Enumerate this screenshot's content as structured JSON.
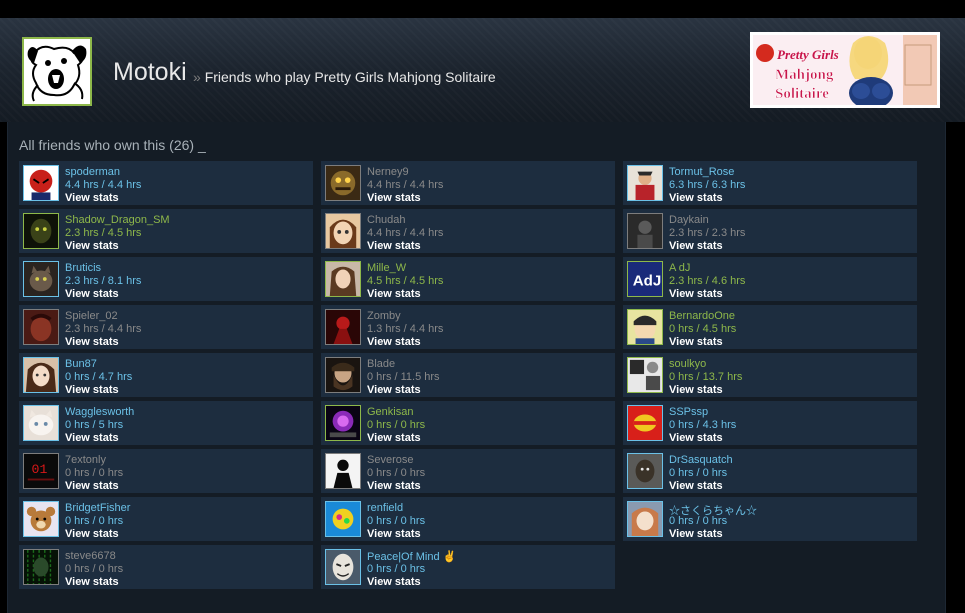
{
  "header": {
    "user_name": "Motoki",
    "separator": "»",
    "subtitle": "Friends who play Pretty Girls Mahjong Solitaire",
    "game_logo_text_1": "Pretty Girls",
    "game_logo_text_2": "Mahjong",
    "game_logo_text_3": "Solitaire"
  },
  "section": {
    "title": "All friends who own this (26) _"
  },
  "colors": {
    "online": "#6bc1e7",
    "in_game": "#8eb84a",
    "offline": "#8a8a8a",
    "card_bg": "#1d2d3f"
  },
  "view_stats_label": "View stats",
  "friends": [
    {
      "name": "spoderman",
      "hours": "4.4 hrs / 4.4 hrs",
      "status": "online",
      "avatar": "red-mask-avatar"
    },
    {
      "name": "Nerney9",
      "hours": "4.4 hrs / 4.4 hrs",
      "status": "offline",
      "avatar": "creature-avatar"
    },
    {
      "name": "Tormut_Rose",
      "hours": "6.3 hrs / 6.3 hrs",
      "status": "online",
      "avatar": "fighter-avatar"
    },
    {
      "name": "Shadow_Dragon_SM",
      "hours": "2.3 hrs / 4.5 hrs",
      "status": "in-game",
      "avatar": "dark-dragon-avatar"
    },
    {
      "name": "Chudah",
      "hours": "4.4 hrs / 4.4 hrs",
      "status": "offline",
      "avatar": "anime-face-avatar"
    },
    {
      "name": "Daykain",
      "hours": "2.3 hrs / 2.3 hrs",
      "status": "offline",
      "avatar": "dark-figure-avatar"
    },
    {
      "name": "Bruticis",
      "hours": "2.3 hrs / 8.1 hrs",
      "status": "online",
      "avatar": "cat-avatar"
    },
    {
      "name": "Mille_W",
      "hours": "4.5 hrs / 4.5 hrs",
      "status": "in-game",
      "avatar": "girl-avatar"
    },
    {
      "name": "A dJ",
      "hours": "2.3 hrs / 4.6 hrs",
      "status": "in-game",
      "avatar": "adj-logo-avatar"
    },
    {
      "name": "Spieler_02",
      "hours": "2.3 hrs / 4.4 hrs",
      "status": "offline",
      "avatar": "red-face-avatar"
    },
    {
      "name": "Zomby",
      "hours": "1.3 hrs / 4.4 hrs",
      "status": "offline",
      "avatar": "red-figure-avatar"
    },
    {
      "name": "BernardoOne",
      "hours": "0 hrs / 4.5 hrs",
      "status": "in-game",
      "avatar": "cartoon-avatar"
    },
    {
      "name": "Bun87",
      "hours": "0 hrs / 4.7 hrs",
      "status": "online",
      "avatar": "girl-face-avatar"
    },
    {
      "name": "Blade",
      "hours": "0 hrs / 11.5 hrs",
      "status": "offline",
      "avatar": "bearded-man-avatar"
    },
    {
      "name": "soulkyo",
      "hours": "0 hrs / 13.7 hrs",
      "status": "in-game",
      "avatar": "manga-avatar"
    },
    {
      "name": "Wagglesworth",
      "hours": "0 hrs / 5 hrs",
      "status": "online",
      "avatar": "kitten-avatar"
    },
    {
      "name": "Genkisan",
      "hours": "0 hrs / 0 hrs",
      "status": "in-game",
      "avatar": "purple-orb-avatar"
    },
    {
      "name": "SSPssp",
      "hours": "0 hrs / 4.3 hrs",
      "status": "online",
      "avatar": "red-yellow-avatar"
    },
    {
      "name": "7extonly",
      "hours": "0 hrs / 0 hrs",
      "status": "offline",
      "avatar": "text-01-avatar"
    },
    {
      "name": "Severose",
      "hours": "0 hrs / 0 hrs",
      "status": "offline",
      "avatar": "silhouette-avatar"
    },
    {
      "name": "DrSasquatch",
      "hours": "0 hrs / 0 hrs",
      "status": "online",
      "avatar": "sasquatch-avatar"
    },
    {
      "name": "BridgetFisher",
      "hours": "0 hrs / 0 hrs",
      "status": "online",
      "avatar": "bear-avatar"
    },
    {
      "name": "renfield",
      "hours": "0 hrs / 0 hrs",
      "status": "online",
      "avatar": "colorful-avatar"
    },
    {
      "name": "☆さくらちゃん☆",
      "hours": "0 hrs / 0 hrs",
      "status": "online",
      "avatar": "sakura-avatar"
    },
    {
      "name": "steve6678",
      "hours": "0 hrs / 0 hrs",
      "status": "offline",
      "avatar": "green-matrix-avatar"
    },
    {
      "name": "Peace|Of Mind ✌",
      "hours": "0 hrs / 0 hrs",
      "status": "online",
      "avatar": "mask-avatar"
    }
  ]
}
